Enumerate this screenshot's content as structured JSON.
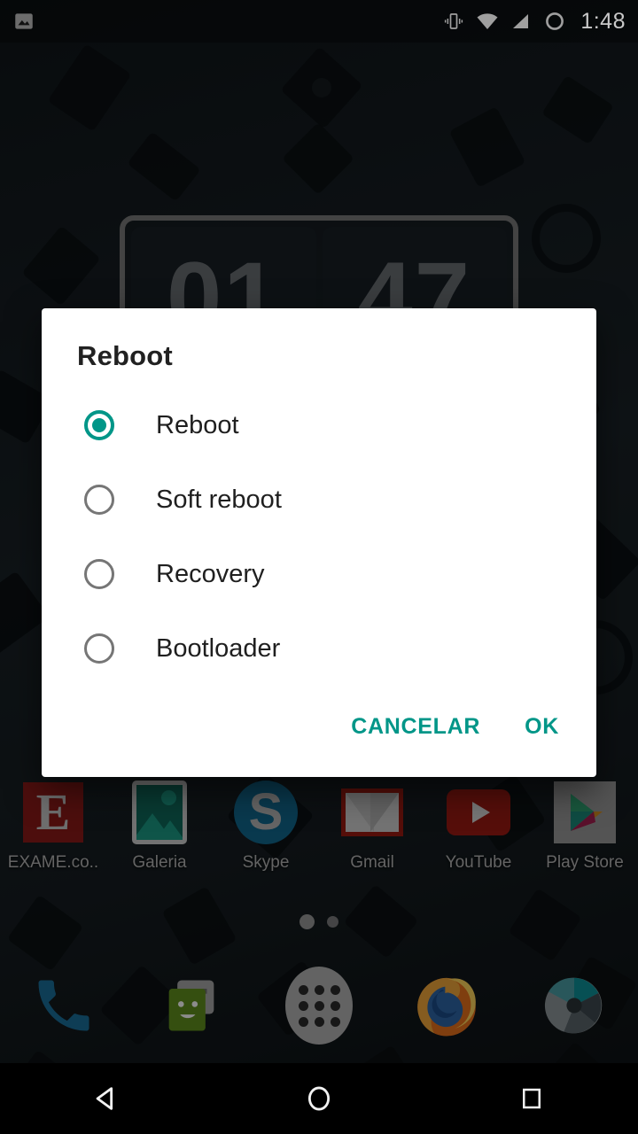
{
  "status_bar": {
    "notification_icon": "image-icon",
    "icons": [
      "vibrate-icon",
      "wifi-icon",
      "signal-icon",
      "battery-ring-icon"
    ],
    "time": "1:48"
  },
  "widget": {
    "name": "flip-clock-widget",
    "hours": "01",
    "minutes": "47"
  },
  "home": {
    "apps": [
      {
        "label": "EXAME.co..",
        "icon": "exame-icon",
        "glyph": "E"
      },
      {
        "label": "Galeria",
        "icon": "gallery-icon"
      },
      {
        "label": "Skype",
        "icon": "skype-icon",
        "glyph": "S"
      },
      {
        "label": "Gmail",
        "icon": "gmail-icon"
      },
      {
        "label": "YouTube",
        "icon": "youtube-icon"
      },
      {
        "label": "Play Store",
        "icon": "play-store-icon"
      }
    ],
    "page_dots": [
      {
        "state": "active"
      },
      {
        "state": "inactive"
      }
    ],
    "dock": [
      {
        "label": "Phone",
        "icon": "phone-icon"
      },
      {
        "label": "Messages",
        "icon": "messages-icon"
      },
      {
        "label": "All apps",
        "icon": "app-drawer-icon"
      },
      {
        "label": "Firefox",
        "icon": "firefox-icon"
      },
      {
        "label": "Camera",
        "icon": "camera-icon"
      }
    ]
  },
  "dialog": {
    "title": "Reboot",
    "options": [
      {
        "label": "Reboot",
        "selected": true
      },
      {
        "label": "Soft reboot",
        "selected": false
      },
      {
        "label": "Recovery",
        "selected": false
      },
      {
        "label": "Bootloader",
        "selected": false
      }
    ],
    "cancel_label": "CANCELAR",
    "ok_label": "OK"
  },
  "nav_bar": {
    "back": "back-icon",
    "home": "home-icon",
    "recents": "recents-icon"
  },
  "colors": {
    "accent": "#009688",
    "dialog_bg": "#ffffff",
    "title_text": "#212121",
    "wallpaper": "#1b2328"
  }
}
